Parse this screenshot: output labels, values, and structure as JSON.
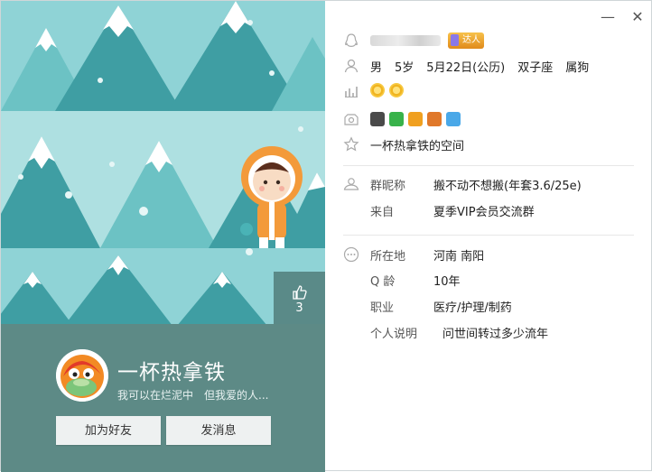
{
  "window": {
    "minimize_glyph": "—",
    "close_glyph": "✕"
  },
  "cover": {
    "like_count": "3"
  },
  "profile": {
    "nickname": "一杯热拿铁",
    "signature": "我可以在烂泥中　但我爱的人...",
    "add_friend_label": "加为好友",
    "send_message_label": "发消息"
  },
  "basic": {
    "daren_badge": "达人",
    "gender": "男",
    "age": "5岁",
    "birthday": "5月22日(公历)",
    "zodiac": "双子座",
    "chinese_zodiac": "属狗",
    "space_name": "一杯热拿铁的空间"
  },
  "group": {
    "nickname_label": "群昵称",
    "nickname_value": "搬不动不想搬(年套3.6/25e)",
    "from_label": "来自",
    "from_value": "夏季VIP会员交流群"
  },
  "details": {
    "location_label": "所在地",
    "location_value": "河南 南阳",
    "qage_label": "Q 龄",
    "qage_value": "10年",
    "job_label": "职业",
    "job_value": "医疗/护理/制药",
    "desc_label": "个人说明",
    "desc_value": "问世间转过多少流年"
  },
  "colors": {
    "footer_bg": "#5d8a86",
    "like_bg": "#5a8a88",
    "sky": "#8fd3d6",
    "tree_dark": "#3f9ea3",
    "tree_light": "#6cc2c4"
  },
  "icons": [
    "penguin-icon",
    "person-icon",
    "level-chart-icon",
    "badge-icon",
    "star-icon",
    "group-person-icon",
    "more-icon",
    "thumb-up-icon"
  ]
}
